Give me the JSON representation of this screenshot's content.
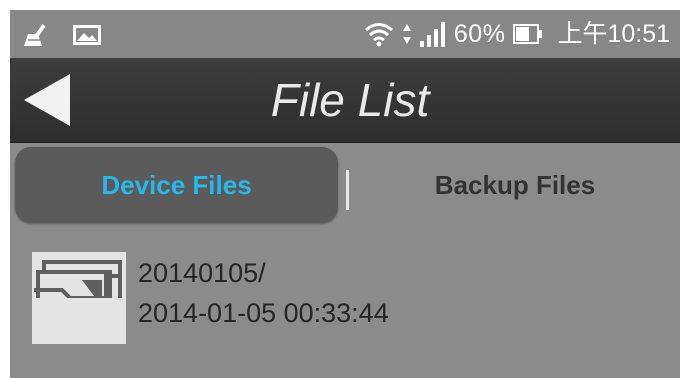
{
  "status_bar": {
    "left_icons": [
      "broom-icon",
      "image-icon"
    ],
    "right_icons": [
      "wifi-icon",
      "data-transfer-icon",
      "signal-icon",
      "battery-icon"
    ],
    "battery_percent": "60%",
    "time": "上午10:51"
  },
  "header": {
    "title": "File List",
    "back_icon": "back-arrow-icon"
  },
  "tabs": [
    {
      "label": "Device Files",
      "selected": true
    },
    {
      "label": "Backup Files",
      "selected": false
    }
  ],
  "files": [
    {
      "icon": "folder-icon",
      "name": "20140105/",
      "date": "2014-01-05 00:33:44"
    }
  ],
  "colors": {
    "accent": "#29b7ea",
    "title_bar": "#353535",
    "background": "#8b8b8b",
    "selected_tab": "#5b5b5b"
  }
}
